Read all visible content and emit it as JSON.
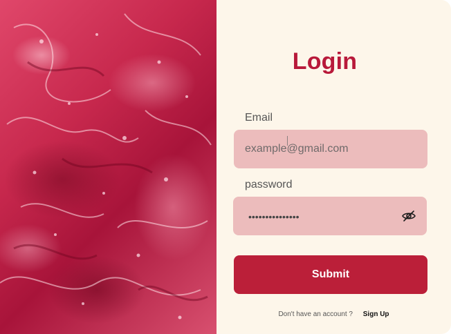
{
  "login": {
    "title": "Login",
    "email": {
      "label": "Email",
      "placeholder": "example@gmail.com"
    },
    "password": {
      "label": "password",
      "masked_value": "•••••••••••••••"
    },
    "submit_label": "Submit",
    "footer": {
      "prompt": "Don't have an account ?",
      "signup_label": "Sign Up"
    }
  },
  "colors": {
    "accent": "#b8193a",
    "panel_background": "#fdf6ea",
    "field_background": "#ecbcbc",
    "button_background": "#bb1f39"
  },
  "icons": {
    "password_toggle": "eye-slash-icon"
  }
}
